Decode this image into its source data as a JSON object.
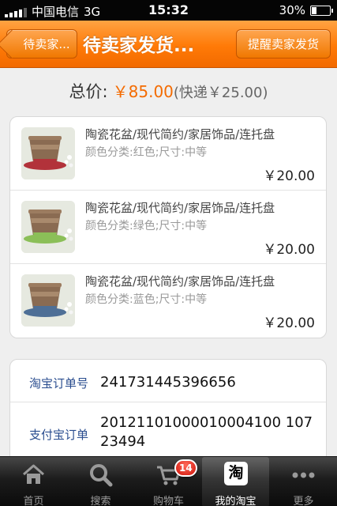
{
  "status_bar": {
    "carrier": "中国电信",
    "network": "3G",
    "time": "15:32",
    "battery_percent": "30%",
    "battery_level": 0.3
  },
  "nav": {
    "back_label": "待卖家...",
    "title": "待卖家发货...",
    "remind_label": "提醒卖家发货"
  },
  "summary": {
    "total_label": "总价:",
    "total_price": "￥85.00",
    "shipping": "(快递￥25.00)"
  },
  "products": [
    {
      "title": "陶瓷花盆/现代简约/家居饰品/连托盘",
      "spec": "颜色分类:红色;尺寸:中等",
      "price": "￥20.00",
      "pot_color": "#b2323a"
    },
    {
      "title": "陶瓷花盆/现代简约/家居饰品/连托盘",
      "spec": "颜色分类:绿色;尺寸:中等",
      "price": "￥20.00",
      "pot_color": "#8bbf58"
    },
    {
      "title": "陶瓷花盆/现代简约/家居饰品/连托盘",
      "spec": "颜色分类:蓝色;尺寸:中等",
      "price": "￥20.00",
      "pot_color": "#4e6f96"
    }
  ],
  "order": {
    "taobao_label": "淘宝订单号",
    "taobao_value": "241731445396656",
    "alipay_label": "支付宝订单",
    "alipay_value": "20121101000010004100 10723494"
  },
  "tabs": [
    {
      "label": "首页",
      "icon": "home-icon"
    },
    {
      "label": "搜索",
      "icon": "search-icon"
    },
    {
      "label": "购物车",
      "icon": "cart-icon",
      "badge": "14"
    },
    {
      "label": "我的淘宝",
      "icon": "taobao-icon",
      "glyph": "淘"
    },
    {
      "label": "更多",
      "icon": "more-icon"
    }
  ],
  "colors": {
    "accent": "#ff7a07",
    "price": "#f46b00",
    "label_blue": "#2a4d8f"
  }
}
